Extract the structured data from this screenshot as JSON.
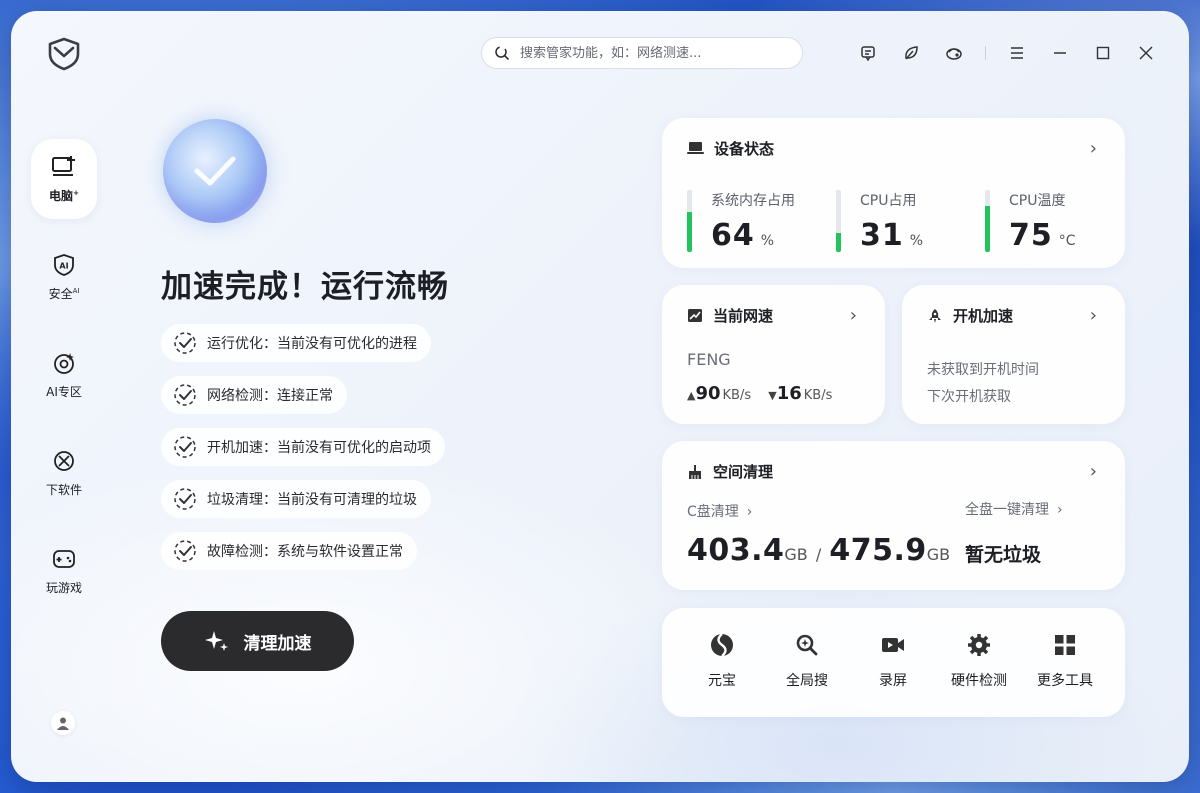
{
  "search": {
    "placeholder": "搜索管家功能，如：网络测速..."
  },
  "sidebar": {
    "items": [
      {
        "label": "电脑",
        "sup": "+"
      },
      {
        "label": "安全",
        "sup": "AI"
      },
      {
        "label": "AI专区",
        "sup": ""
      },
      {
        "label": "下软件",
        "sup": ""
      },
      {
        "label": "玩游戏",
        "sup": ""
      }
    ]
  },
  "main": {
    "headline": "加速完成！运行流畅",
    "checks": [
      "运行优化：当前没有可优化的进程",
      "网络检测：连接正常",
      "开机加速：当前没有可优化的启动项",
      "垃圾清理：当前没有可清理的垃圾",
      "故障检测：系统与软件设置正常"
    ],
    "cta": "清理加速"
  },
  "device_status": {
    "title": "设备状态",
    "metrics": [
      {
        "label": "系统内存占用",
        "value": "64",
        "unit": "%",
        "fill": 0.64
      },
      {
        "label": "CPU占用",
        "value": "31",
        "unit": "%",
        "fill": 0.31
      },
      {
        "label": "CPU温度",
        "value": "75",
        "unit": "°C",
        "fill": 0.75
      }
    ]
  },
  "network": {
    "title": "当前网速",
    "ssid": "FENG",
    "up": "90",
    "up_unit": "KB/s",
    "down": "16",
    "down_unit": "KB/s"
  },
  "boot": {
    "title": "开机加速",
    "line1": "未获取到开机时间",
    "line2": "下次开机获取"
  },
  "space": {
    "title": "空间清理",
    "c_label": "C盘清理",
    "used": "403.4",
    "used_unit": "GB",
    "sep": "/",
    "total": "475.9",
    "total_unit": "GB",
    "full_label": "全盘一键清理",
    "full_status": "暂无垃圾"
  },
  "tools": [
    "元宝",
    "全局搜",
    "录屏",
    "硬件检测",
    "更多工具"
  ],
  "colors": {
    "ok_green": "#22c35c",
    "cta_bg": "#2b2b2e",
    "accent_blue": "#2a64d8"
  }
}
